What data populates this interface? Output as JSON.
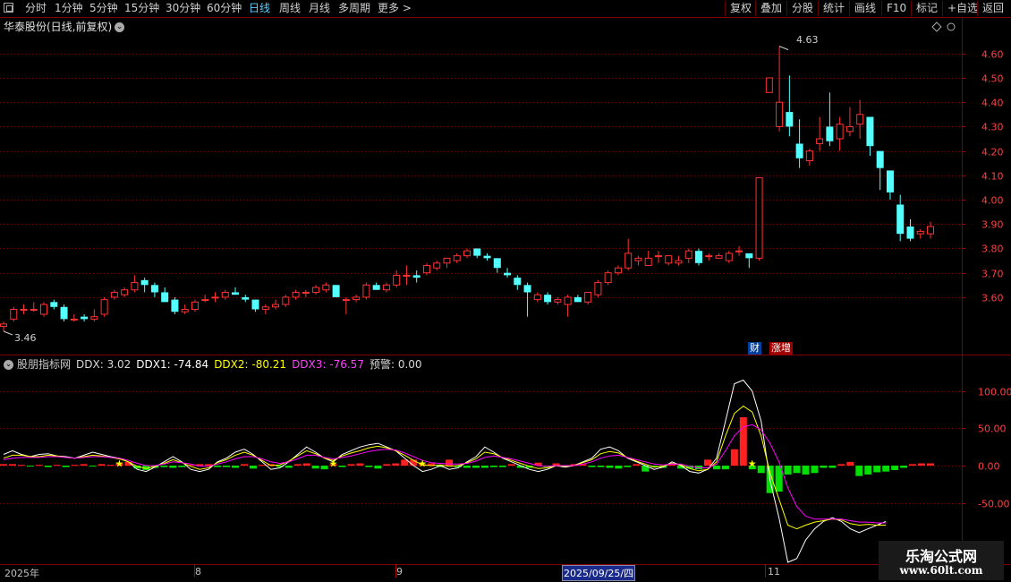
{
  "toolbar": {
    "left_items": [
      "分时",
      "1分钟",
      "5分钟",
      "15分钟",
      "30分钟",
      "60分钟",
      "日线",
      "周线",
      "月线",
      "多周期",
      "更多 >"
    ],
    "active": "日线",
    "right_items": [
      "复权",
      "叠加",
      "分股",
      "统计",
      "画线",
      "F10",
      "标记",
      "+自选",
      "返回"
    ]
  },
  "stock": {
    "title": "华泰股份(日线,前复权)"
  },
  "price_axis": {
    "ticks": [
      "4.60",
      "4.50",
      "4.40",
      "4.30",
      "4.20",
      "4.10",
      "4.00",
      "3.90",
      "3.80",
      "3.70",
      "3.60"
    ]
  },
  "annotations": {
    "high": "4.63",
    "low": "3.46"
  },
  "badges": {
    "cai": "财",
    "zhang": "涨增"
  },
  "indicator": {
    "name": "股朋指标网",
    "ddx": "DDX: 3.02",
    "ddx1": "DDX1: -74.84",
    "ddx2": "DDX2: -80.21",
    "ddx3": "DDX3: -76.57",
    "warn": "预警: 0.00",
    "axis_ticks": [
      "100.00",
      "50.00",
      "0.00",
      "-50.00"
    ]
  },
  "time_axis": {
    "labels": [
      "2025年",
      "8",
      "9",
      "2025/09/25/四",
      "11"
    ]
  },
  "watermark": {
    "title": "乐淘公式网",
    "url": "www.60lt.com"
  },
  "colors": {
    "up": "#ff3232",
    "down": "#54ffff",
    "ddx1": "#ffffff",
    "ddx2": "#ffff00",
    "ddx3": "#ff00ff",
    "grid": "#800000",
    "star": "#ffff00"
  },
  "chart_data": [
    {
      "type": "candlestick",
      "title": "华泰股份(日线,前复权)",
      "ylim": [
        3.46,
        4.68
      ],
      "candles": [
        {
          "o": 3.48,
          "h": 3.5,
          "l": 3.46,
          "c": 3.49
        },
        {
          "o": 3.51,
          "h": 3.56,
          "l": 3.5,
          "c": 3.55
        },
        {
          "o": 3.55,
          "h": 3.57,
          "l": 3.53,
          "c": 3.55
        },
        {
          "o": 3.55,
          "h": 3.58,
          "l": 3.54,
          "c": 3.55
        },
        {
          "o": 3.53,
          "h": 3.58,
          "l": 3.52,
          "c": 3.57
        },
        {
          "o": 3.58,
          "h": 3.59,
          "l": 3.55,
          "c": 3.56
        },
        {
          "o": 3.56,
          "h": 3.57,
          "l": 3.5,
          "c": 3.51
        },
        {
          "o": 3.51,
          "h": 3.53,
          "l": 3.5,
          "c": 3.51
        },
        {
          "o": 3.52,
          "h": 3.53,
          "l": 3.5,
          "c": 3.51
        },
        {
          "o": 3.51,
          "h": 3.55,
          "l": 3.5,
          "c": 3.52
        },
        {
          "o": 3.53,
          "h": 3.6,
          "l": 3.52,
          "c": 3.59
        },
        {
          "o": 3.6,
          "h": 3.63,
          "l": 3.59,
          "c": 3.62
        },
        {
          "o": 3.61,
          "h": 3.64,
          "l": 3.6,
          "c": 3.63
        },
        {
          "o": 3.63,
          "h": 3.69,
          "l": 3.62,
          "c": 3.66
        },
        {
          "o": 3.67,
          "h": 3.68,
          "l": 3.62,
          "c": 3.65
        },
        {
          "o": 3.65,
          "h": 3.66,
          "l": 3.6,
          "c": 3.62
        },
        {
          "o": 3.62,
          "h": 3.64,
          "l": 3.58,
          "c": 3.58
        },
        {
          "o": 3.59,
          "h": 3.6,
          "l": 3.53,
          "c": 3.54
        },
        {
          "o": 3.54,
          "h": 3.57,
          "l": 3.53,
          "c": 3.55
        },
        {
          "o": 3.55,
          "h": 3.59,
          "l": 3.54,
          "c": 3.58
        },
        {
          "o": 3.59,
          "h": 3.61,
          "l": 3.58,
          "c": 3.59
        },
        {
          "o": 3.6,
          "h": 3.62,
          "l": 3.58,
          "c": 3.6
        },
        {
          "o": 3.6,
          "h": 3.63,
          "l": 3.59,
          "c": 3.62
        },
        {
          "o": 3.62,
          "h": 3.64,
          "l": 3.61,
          "c": 3.61
        },
        {
          "o": 3.6,
          "h": 3.61,
          "l": 3.58,
          "c": 3.59
        },
        {
          "o": 3.59,
          "h": 3.59,
          "l": 3.54,
          "c": 3.55
        },
        {
          "o": 3.55,
          "h": 3.57,
          "l": 3.53,
          "c": 3.56
        },
        {
          "o": 3.56,
          "h": 3.59,
          "l": 3.55,
          "c": 3.57
        },
        {
          "o": 3.57,
          "h": 3.61,
          "l": 3.56,
          "c": 3.6
        },
        {
          "o": 3.6,
          "h": 3.63,
          "l": 3.59,
          "c": 3.62
        },
        {
          "o": 3.62,
          "h": 3.63,
          "l": 3.6,
          "c": 3.62
        },
        {
          "o": 3.62,
          "h": 3.65,
          "l": 3.61,
          "c": 3.64
        },
        {
          "o": 3.63,
          "h": 3.66,
          "l": 3.62,
          "c": 3.65
        },
        {
          "o": 3.65,
          "h": 3.65,
          "l": 3.6,
          "c": 3.6
        },
        {
          "o": 3.59,
          "h": 3.6,
          "l": 3.53,
          "c": 3.59
        },
        {
          "o": 3.59,
          "h": 3.61,
          "l": 3.58,
          "c": 3.6
        },
        {
          "o": 3.6,
          "h": 3.66,
          "l": 3.59,
          "c": 3.65
        },
        {
          "o": 3.65,
          "h": 3.66,
          "l": 3.63,
          "c": 3.63
        },
        {
          "o": 3.63,
          "h": 3.66,
          "l": 3.62,
          "c": 3.65
        },
        {
          "o": 3.65,
          "h": 3.71,
          "l": 3.64,
          "c": 3.69
        },
        {
          "o": 3.69,
          "h": 3.73,
          "l": 3.65,
          "c": 3.69
        },
        {
          "o": 3.69,
          "h": 3.71,
          "l": 3.66,
          "c": 3.68
        },
        {
          "o": 3.7,
          "h": 3.74,
          "l": 3.69,
          "c": 3.73
        },
        {
          "o": 3.72,
          "h": 3.75,
          "l": 3.71,
          "c": 3.74
        },
        {
          "o": 3.74,
          "h": 3.76,
          "l": 3.72,
          "c": 3.76
        },
        {
          "o": 3.75,
          "h": 3.78,
          "l": 3.74,
          "c": 3.77
        },
        {
          "o": 3.77,
          "h": 3.8,
          "l": 3.76,
          "c": 3.79
        },
        {
          "o": 3.8,
          "h": 3.8,
          "l": 3.76,
          "c": 3.77
        },
        {
          "o": 3.77,
          "h": 3.78,
          "l": 3.75,
          "c": 3.76
        },
        {
          "o": 3.76,
          "h": 3.76,
          "l": 3.7,
          "c": 3.72
        },
        {
          "o": 3.7,
          "h": 3.72,
          "l": 3.68,
          "c": 3.69
        },
        {
          "o": 3.68,
          "h": 3.69,
          "l": 3.63,
          "c": 3.65
        },
        {
          "o": 3.65,
          "h": 3.66,
          "l": 3.52,
          "c": 3.62
        },
        {
          "o": 3.59,
          "h": 3.62,
          "l": 3.58,
          "c": 3.61
        },
        {
          "o": 3.61,
          "h": 3.62,
          "l": 3.57,
          "c": 3.58
        },
        {
          "o": 3.58,
          "h": 3.6,
          "l": 3.57,
          "c": 3.59
        },
        {
          "o": 3.57,
          "h": 3.61,
          "l": 3.52,
          "c": 3.6
        },
        {
          "o": 3.6,
          "h": 3.61,
          "l": 3.58,
          "c": 3.58
        },
        {
          "o": 3.58,
          "h": 3.62,
          "l": 3.57,
          "c": 3.62
        },
        {
          "o": 3.61,
          "h": 3.67,
          "l": 3.6,
          "c": 3.66
        },
        {
          "o": 3.66,
          "h": 3.71,
          "l": 3.65,
          "c": 3.7
        },
        {
          "o": 3.7,
          "h": 3.73,
          "l": 3.69,
          "c": 3.72
        },
        {
          "o": 3.72,
          "h": 3.84,
          "l": 3.71,
          "c": 3.78
        },
        {
          "o": 3.75,
          "h": 3.77,
          "l": 3.73,
          "c": 3.76
        },
        {
          "o": 3.73,
          "h": 3.79,
          "l": 3.73,
          "c": 3.76
        },
        {
          "o": 3.77,
          "h": 3.79,
          "l": 3.74,
          "c": 3.77
        },
        {
          "o": 3.74,
          "h": 3.77,
          "l": 3.73,
          "c": 3.77
        },
        {
          "o": 3.74,
          "h": 3.77,
          "l": 3.73,
          "c": 3.75
        },
        {
          "o": 3.76,
          "h": 3.8,
          "l": 3.74,
          "c": 3.79
        },
        {
          "o": 3.79,
          "h": 3.8,
          "l": 3.73,
          "c": 3.74
        },
        {
          "o": 3.77,
          "h": 3.78,
          "l": 3.75,
          "c": 3.77
        },
        {
          "o": 3.76,
          "h": 3.78,
          "l": 3.76,
          "c": 3.77
        },
        {
          "o": 3.75,
          "h": 3.79,
          "l": 3.74,
          "c": 3.78
        },
        {
          "o": 3.79,
          "h": 3.81,
          "l": 3.77,
          "c": 3.79
        },
        {
          "o": 3.78,
          "h": 3.78,
          "l": 3.72,
          "c": 3.76
        },
        {
          "o": 3.76,
          "h": 4.09,
          "l": 3.75,
          "c": 4.09
        },
        {
          "o": 4.44,
          "h": 4.5,
          "l": 4.44,
          "c": 4.5
        },
        {
          "o": 4.3,
          "h": 4.63,
          "l": 4.28,
          "c": 4.4
        },
        {
          "o": 4.36,
          "h": 4.51,
          "l": 4.26,
          "c": 4.3
        },
        {
          "o": 4.23,
          "h": 4.33,
          "l": 4.13,
          "c": 4.17
        },
        {
          "o": 4.16,
          "h": 4.21,
          "l": 4.14,
          "c": 4.2
        },
        {
          "o": 4.23,
          "h": 4.34,
          "l": 4.2,
          "c": 4.25
        },
        {
          "o": 4.3,
          "h": 4.44,
          "l": 4.22,
          "c": 4.24
        },
        {
          "o": 4.25,
          "h": 4.34,
          "l": 4.2,
          "c": 4.31
        },
        {
          "o": 4.28,
          "h": 4.38,
          "l": 4.26,
          "c": 4.3
        },
        {
          "o": 4.31,
          "h": 4.41,
          "l": 4.25,
          "c": 4.35
        },
        {
          "o": 4.34,
          "h": 4.34,
          "l": 4.18,
          "c": 4.22
        },
        {
          "o": 4.2,
          "h": 4.2,
          "l": 4.04,
          "c": 4.13
        },
        {
          "o": 4.12,
          "h": 4.12,
          "l": 4.0,
          "c": 4.03
        },
        {
          "o": 3.98,
          "h": 4.02,
          "l": 3.83,
          "c": 3.86
        },
        {
          "o": 3.89,
          "h": 3.92,
          "l": 3.83,
          "c": 3.84
        },
        {
          "o": 3.86,
          "h": 3.88,
          "l": 3.84,
          "c": 3.87
        },
        {
          "o": 3.86,
          "h": 3.91,
          "l": 3.84,
          "c": 3.89
        }
      ]
    },
    {
      "type": "bar+line",
      "title": "股朋指标网",
      "ylim": [
        -130,
        130
      ],
      "series": [
        {
          "name": "DDX",
          "values": [
            2,
            2,
            1,
            -1,
            1,
            -2,
            1,
            -2,
            1,
            2,
            -1,
            2,
            1,
            3,
            5,
            -4,
            -6,
            -3,
            -2,
            -3,
            -2,
            1,
            2,
            2,
            -2,
            -2,
            -3,
            2,
            -4,
            1,
            2,
            -2,
            -3,
            2,
            3,
            -4,
            -5,
            2,
            -2,
            2,
            3,
            -2,
            -4,
            2,
            3,
            8,
            8,
            2,
            3,
            -2,
            8,
            -2,
            -3,
            -3,
            -3,
            -2,
            -2,
            2,
            -3,
            -3,
            4,
            -2,
            3,
            -2,
            2,
            2,
            -2,
            -2,
            -3,
            -4,
            -2,
            2,
            -8,
            -2,
            -3,
            2,
            -4,
            -4,
            -5,
            8,
            -5,
            -5,
            22,
            65,
            -5,
            -10,
            -37,
            -35,
            -12,
            -10,
            -12,
            -10,
            -3,
            -3,
            2,
            5,
            -14,
            -12,
            -9,
            -8,
            -6,
            -3,
            2,
            3,
            3
          ]
        },
        {
          "name": "DDX1",
          "values": [
            15,
            20,
            15,
            12,
            15,
            16,
            13,
            12,
            10,
            14,
            18,
            15,
            12,
            10,
            5,
            -5,
            -8,
            -2,
            5,
            12,
            5,
            -5,
            -8,
            -5,
            5,
            10,
            18,
            22,
            15,
            5,
            -5,
            -3,
            5,
            15,
            25,
            18,
            10,
            5,
            15,
            20,
            25,
            28,
            30,
            25,
            20,
            10,
            0,
            -8,
            -5,
            0,
            -5,
            -3,
            5,
            12,
            25,
            18,
            10,
            5,
            0,
            -5,
            -8,
            -5,
            0,
            -2,
            0,
            5,
            10,
            22,
            25,
            20,
            10,
            5,
            0,
            -5,
            -2,
            5,
            0,
            -8,
            -10,
            -5,
            10,
            60,
            110,
            115,
            100,
            60,
            -20,
            -70,
            -130,
            -125,
            -100,
            -85,
            -75,
            -70,
            -75,
            -85,
            -90,
            -85,
            -80,
            -75
          ]
        },
        {
          "name": "DDX2",
          "values": [
            10,
            14,
            14,
            12,
            12,
            14,
            13,
            11,
            10,
            12,
            14,
            13,
            11,
            9,
            5,
            -1,
            -4,
            -1,
            3,
            8,
            4,
            -1,
            -5,
            -3,
            4,
            8,
            14,
            18,
            14,
            7,
            0,
            1,
            6,
            13,
            20,
            16,
            10,
            7,
            13,
            17,
            20,
            24,
            26,
            24,
            20,
            14,
            7,
            1,
            0,
            1,
            -1,
            0,
            4,
            9,
            18,
            16,
            11,
            7,
            3,
            -1,
            -4,
            -3,
            0,
            -1,
            0,
            4,
            8,
            16,
            19,
            17,
            11,
            6,
            2,
            -2,
            -1,
            3,
            1,
            -4,
            -7,
            -5,
            5,
            40,
            70,
            80,
            72,
            40,
            -10,
            -45,
            -80,
            -85,
            -80,
            -76,
            -74,
            -72,
            -73,
            -78,
            -80,
            -79,
            -80,
            -80
          ]
        },
        {
          "name": "DDX3",
          "values": [
            8,
            10,
            11,
            11,
            11,
            12,
            12,
            11,
            10,
            11,
            12,
            12,
            11,
            10,
            7,
            3,
            0,
            0,
            2,
            5,
            4,
            2,
            -1,
            -1,
            2,
            5,
            9,
            12,
            12,
            9,
            5,
            3,
            5,
            9,
            14,
            14,
            11,
            9,
            11,
            13,
            16,
            19,
            21,
            22,
            21,
            17,
            12,
            7,
            4,
            3,
            2,
            2,
            3,
            6,
            11,
            13,
            11,
            9,
            6,
            3,
            0,
            -1,
            0,
            0,
            0,
            2,
            5,
            10,
            13,
            14,
            11,
            8,
            5,
            2,
            1,
            2,
            2,
            -1,
            -3,
            -3,
            2,
            20,
            40,
            52,
            55,
            48,
            30,
            5,
            -30,
            -55,
            -68,
            -72,
            -72,
            -72,
            -72,
            -74,
            -76,
            -76,
            -77,
            -77
          ]
        }
      ],
      "stars_at_index": [
        13,
        37,
        47,
        84
      ]
    }
  ]
}
